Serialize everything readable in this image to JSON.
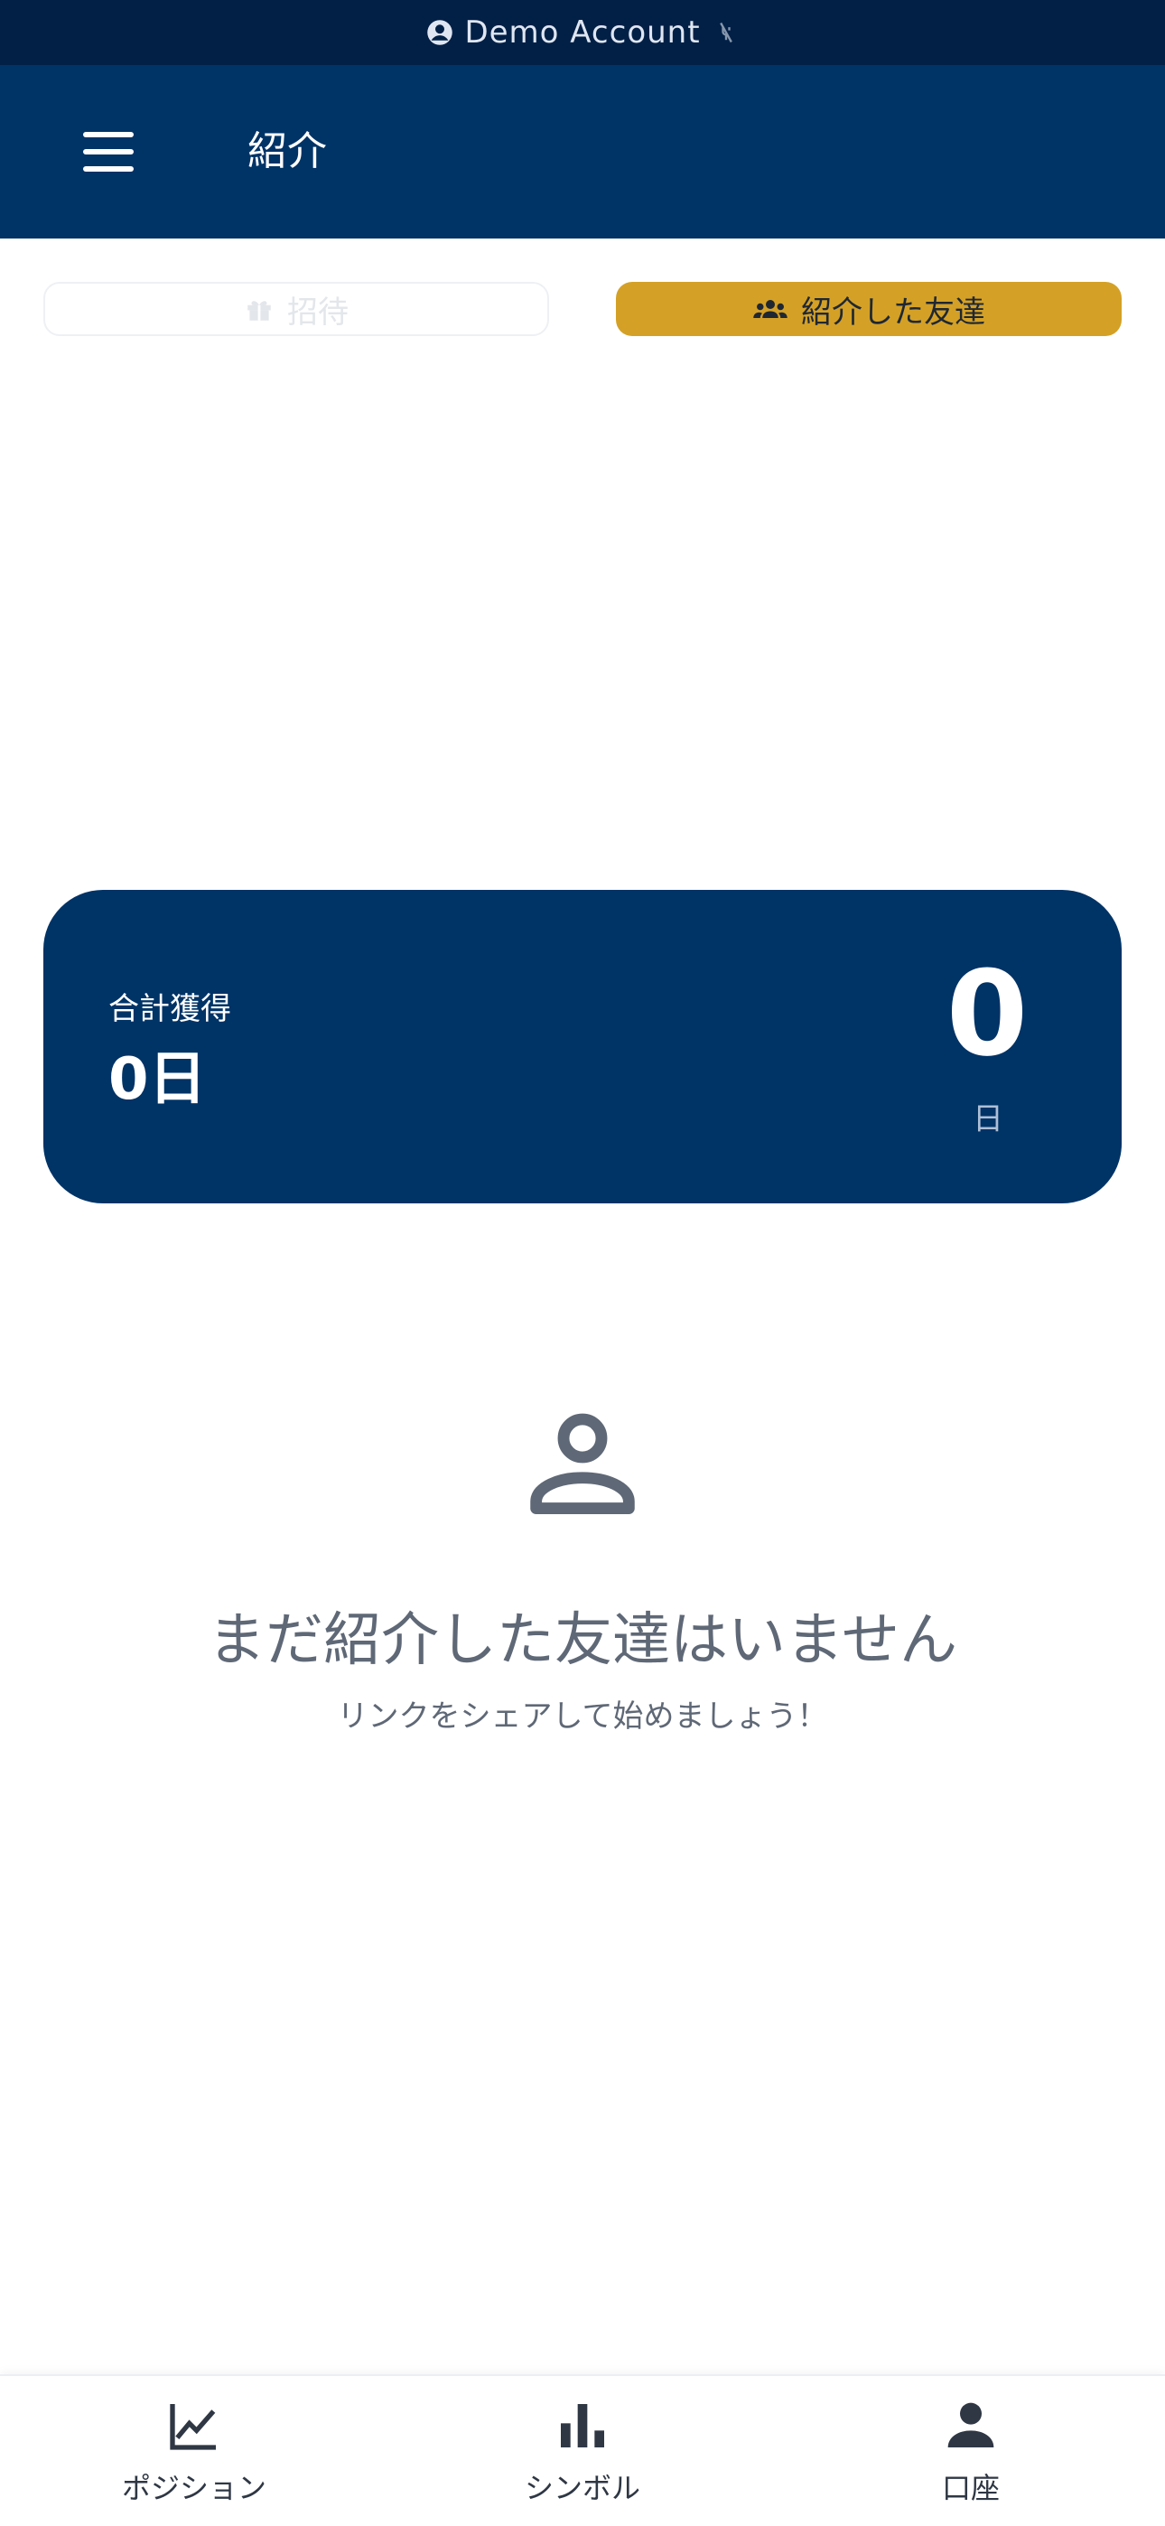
{
  "demo_bar": {
    "label": "Demo Account"
  },
  "header": {
    "title": "紹介"
  },
  "tabs": [
    {
      "label": "招待",
      "icon": "gift-icon",
      "active": false
    },
    {
      "label": "紹介した友達",
      "icon": "users-icon",
      "active": true
    }
  ],
  "card": {
    "label": "合計獲得",
    "value": "0日",
    "big_number": "0",
    "unit": "日"
  },
  "empty_state": {
    "icon": "user-icon",
    "title": "まだ紹介した友達はいません",
    "subtitle": "リンクをシェアして始めましょう！"
  },
  "bottom_nav": [
    {
      "label": "ポジション",
      "icon": "line-chart-icon"
    },
    {
      "label": "シンボル",
      "icon": "bar-chart-icon"
    },
    {
      "label": "口座",
      "icon": "account-icon"
    }
  ],
  "colors": {
    "primary": "#003366",
    "demo_bar": "#022046",
    "accent": "#d4a126",
    "muted_text": "#5f6876"
  }
}
